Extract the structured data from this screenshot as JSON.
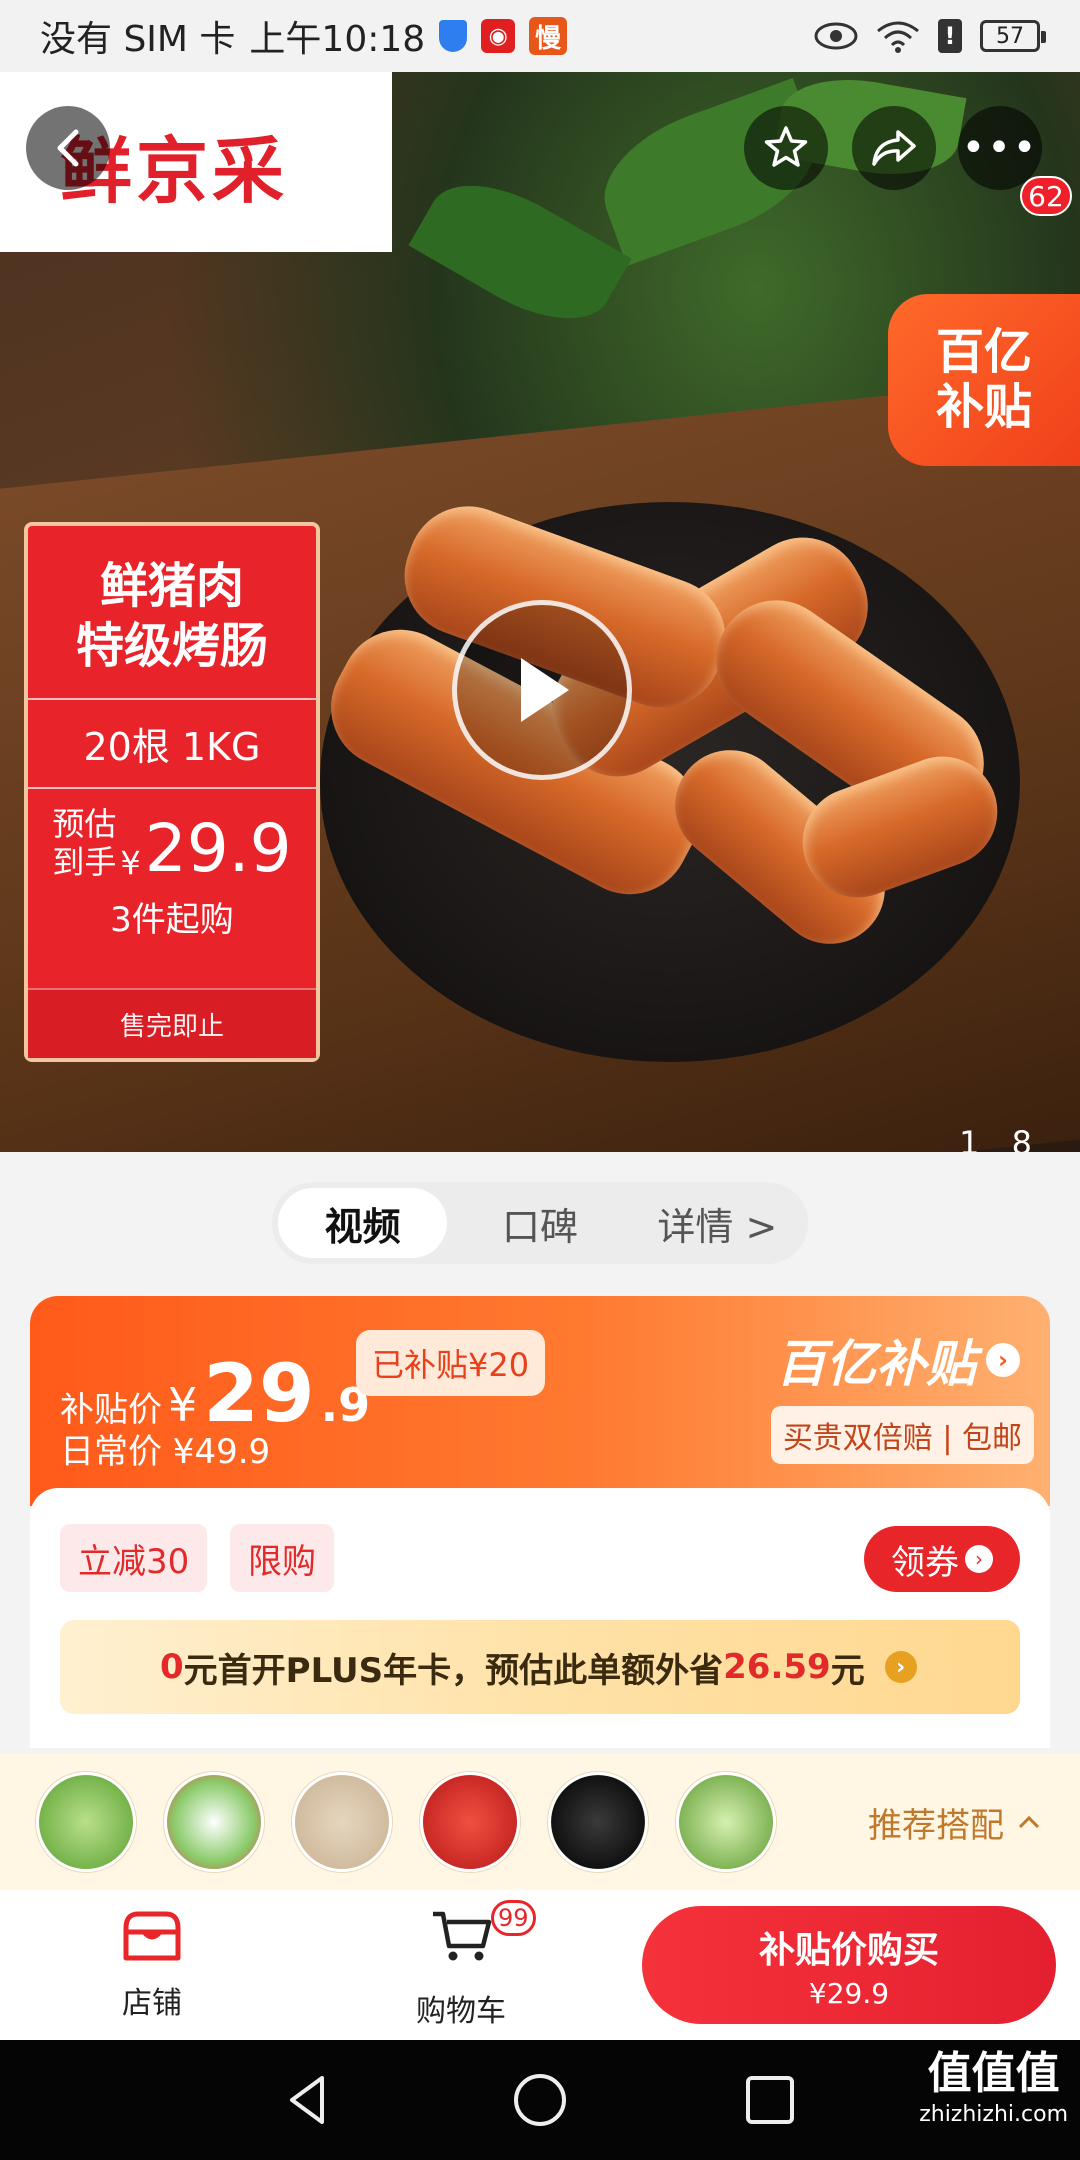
{
  "statusbar": {
    "carrier": "没有 SIM 卡",
    "time": "上午10:18",
    "app_badge": "慢",
    "battery": "57"
  },
  "hero": {
    "brand": "鲜京采",
    "cart_count_badge": "62",
    "subsidy_tag": [
      "百亿",
      "补贴"
    ],
    "promo": {
      "title_line1": "鲜猪肉",
      "title_line2": "特级烤肠",
      "spec": "20根 1KG",
      "est_label1": "预估",
      "est_label2": "到手",
      "currency": "¥",
      "price": "29.9",
      "min_qty": "3件起购",
      "footer": "售完即止"
    },
    "image_counter": {
      "current": "1",
      "total": "8"
    }
  },
  "tabs": [
    {
      "label": "视频",
      "active": true
    },
    {
      "label": "口碑",
      "active": false
    },
    {
      "label": "详情 >",
      "active": false
    }
  ],
  "price_banner": {
    "subsidy_label": "补贴价",
    "currency": "¥",
    "price_int": "29",
    "price_dec": ".9",
    "subsidized": "已补贴¥20",
    "daily_price": "日常价 ¥49.9",
    "program_logo": "百亿补贴",
    "guarantee": "买贵双倍赔 | 包邮"
  },
  "coupons": {
    "chips": [
      "立减30",
      "限购"
    ],
    "claim_label": "领券",
    "plus_pre": "0",
    "plus_mid": "元首开PLUS年卡，预估此单额外省",
    "plus_amount": "26.59",
    "plus_post": "元"
  },
  "recommend": {
    "label": "推荐搭配"
  },
  "actionbar": {
    "store": "店铺",
    "cart": "购物车",
    "cart_badge": "99",
    "buy_title": "补贴价购买",
    "buy_price": "¥29.9"
  },
  "watermark": {
    "main": "值值值",
    "sub": "zhizhizhi.com"
  },
  "colors": {
    "accent_red": "#e8262a",
    "orange": "#ff5a1a",
    "plus_gold": "#ffe2a8"
  }
}
